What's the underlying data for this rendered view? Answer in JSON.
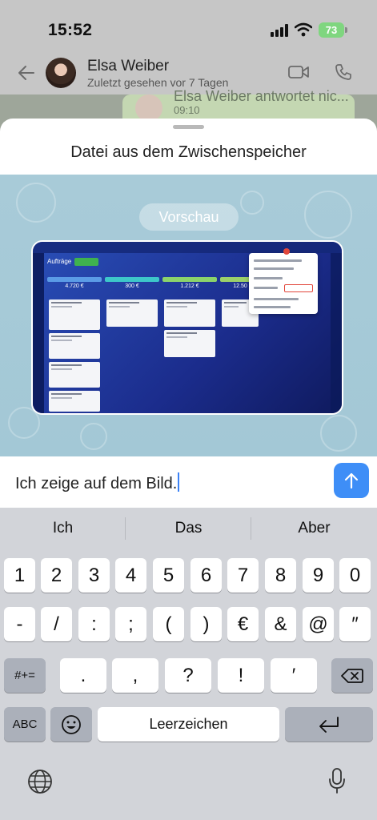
{
  "status_bar": {
    "time": "15:52",
    "battery": "73"
  },
  "chat_header": {
    "contact_name": "Elsa Weiber",
    "contact_status": "Zuletzt gesehen vor 7 Tagen"
  },
  "background_message": {
    "text": "Elsa Weiber antwortet nic...",
    "time": "09:10"
  },
  "sheet": {
    "title": "Datei aus dem Zwischenspeicher",
    "preview_label": "Vorschau",
    "preview_image": {
      "toolbar_title": "Aufträge",
      "column_sums": [
        "4.720 €",
        "300 €",
        "1.212 €",
        "12.50"
      ]
    }
  },
  "composer": {
    "message": "Ich zeige auf dem Bild.",
    "send_icon": "arrow-up-icon"
  },
  "keyboard": {
    "suggestions": [
      "Ich",
      "Das",
      "Aber"
    ],
    "row1": [
      "1",
      "2",
      "3",
      "4",
      "5",
      "6",
      "7",
      "8",
      "9",
      "0"
    ],
    "row2": [
      "-",
      "/",
      ":",
      ";",
      "(",
      ")",
      "€",
      "&",
      "@",
      "″"
    ],
    "row3_left": "#+=",
    "row3_keys": [
      ".",
      ",",
      "?",
      "!",
      "′"
    ],
    "row4_abc": "ABC",
    "row4_space": "Leerzeichen",
    "icons": [
      "backspace-icon",
      "emoji-icon",
      "return-icon",
      "globe-icon",
      "microphone-icon"
    ]
  },
  "colors": {
    "accent": "#3e8ef7",
    "keyboard_bg": "#d2d4d9",
    "key_dark": "#abb0ba"
  }
}
